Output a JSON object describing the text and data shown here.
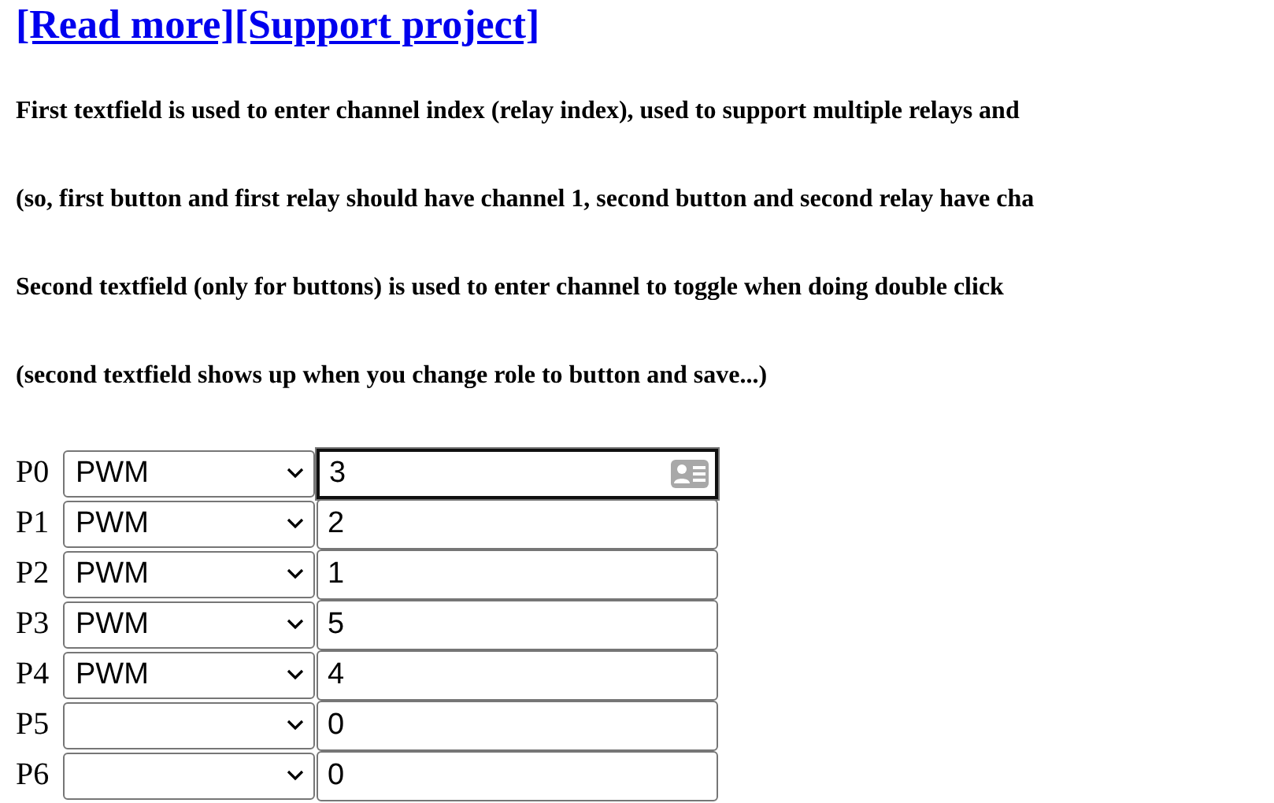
{
  "links": [
    {
      "text": "[Read more]"
    },
    {
      "text": "[Support project]"
    }
  ],
  "paragraphs": [
    "First textfield is used to enter channel index (relay index), used to support multiple relays and",
    "(so, first button and first relay should have channel 1, second button and second relay have cha",
    "Second textfield (only for buttons) is used to enter channel to toggle when doing double click",
    "(second textfield shows up when you change role to button and save...)"
  ],
  "pins": [
    {
      "label": "P0",
      "role": "PWM",
      "channel": "3",
      "focused": true
    },
    {
      "label": "P1",
      "role": "PWM",
      "channel": "2",
      "focused": false
    },
    {
      "label": "P2",
      "role": "PWM",
      "channel": "1",
      "focused": false
    },
    {
      "label": "P3",
      "role": "PWM",
      "channel": "5",
      "focused": false
    },
    {
      "label": "P4",
      "role": "PWM",
      "channel": "4",
      "focused": false
    },
    {
      "label": "P5",
      "channel": "0",
      "focused": false
    },
    {
      "label": "P6",
      "channel": "0",
      "focused": false
    }
  ]
}
